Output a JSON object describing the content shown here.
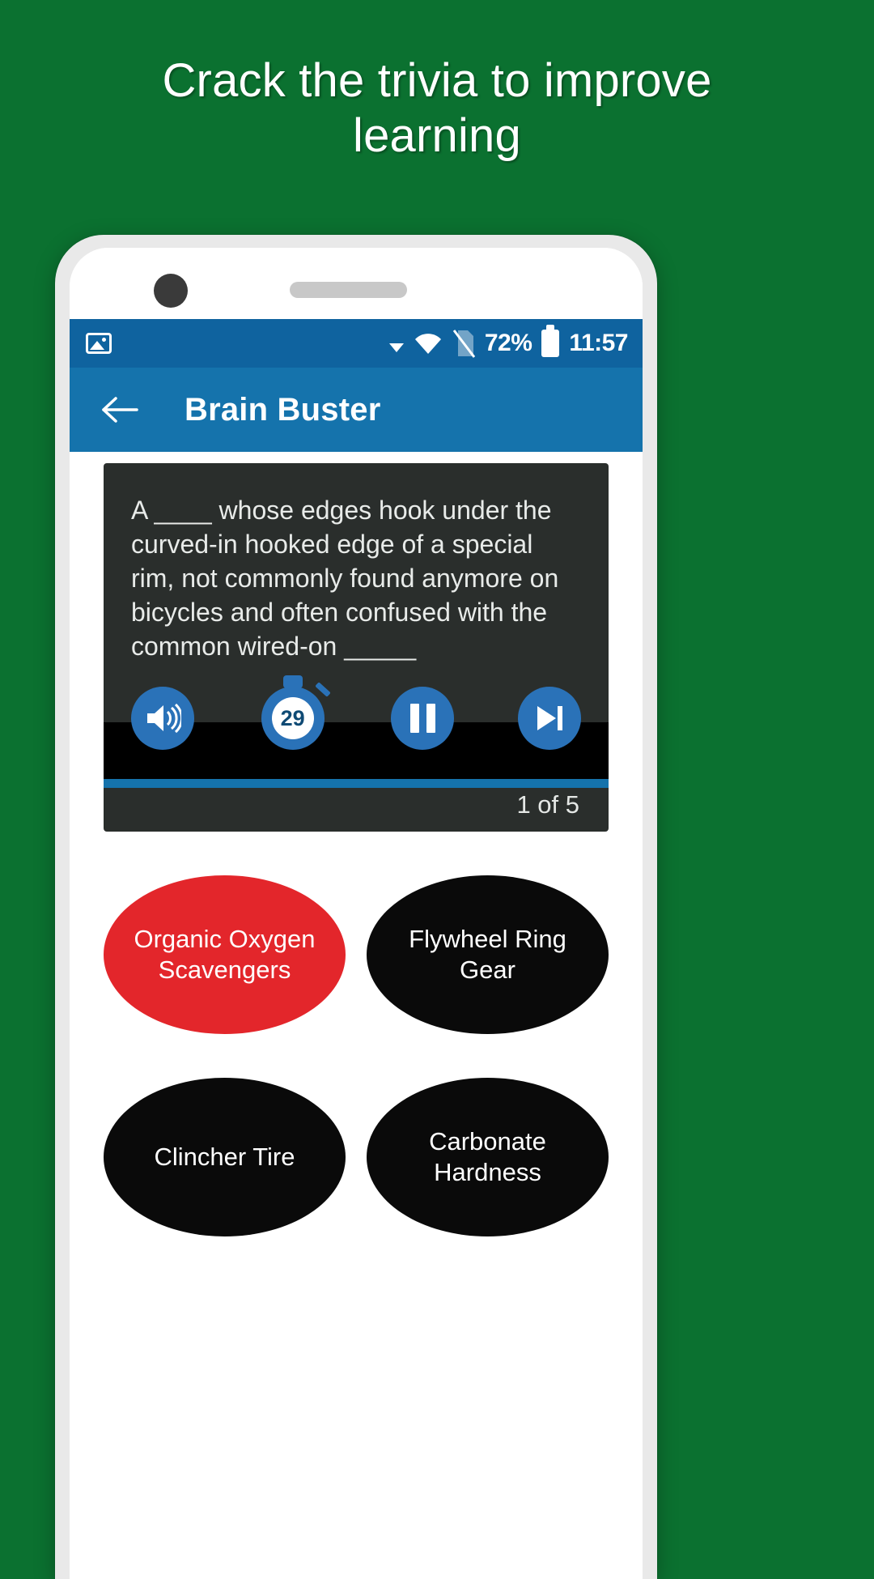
{
  "promo": {
    "headline": "Crack the trivia to improve learning",
    "background_color": "#0b7130",
    "text_color": "#ffffff"
  },
  "status_bar": {
    "background_color": "#0f639f",
    "left_icons": [
      "image-icon"
    ],
    "right_icons": [
      "caret-down-icon",
      "wifi-icon",
      "sim-card-off-icon"
    ],
    "battery_percent": "72%",
    "battery_icon": "battery-icon",
    "time": "11:57"
  },
  "app_bar": {
    "back_icon": "back-arrow-icon",
    "title": "Brain Buster",
    "background_color": "#1573ac",
    "text_color": "#ffffff"
  },
  "question_card": {
    "background_color": "#2a2e2c",
    "text": "A ____ whose edges hook under the curved-in hooked edge of a special rim, not commonly found anymore on bicycles and often confused with the common wired-on _____",
    "counter": "1 of 5",
    "progress_percent": 100,
    "progress_color": "#1573ac",
    "controls": [
      {
        "name": "volume-button",
        "icon": "volume-up-icon",
        "label": ""
      },
      {
        "name": "timer-button",
        "icon": "stopwatch-icon",
        "label": "29"
      },
      {
        "name": "pause-button",
        "icon": "pause-icon",
        "label": ""
      },
      {
        "name": "next-button",
        "icon": "skip-next-icon",
        "label": ""
      }
    ]
  },
  "answers": [
    {
      "label": "Organic Oxygen Scavengers",
      "state": "selected",
      "color": "#e3262b"
    },
    {
      "label": "Flywheel Ring Gear",
      "state": "default",
      "color": "#0a0a0a"
    },
    {
      "label": "Clincher Tire",
      "state": "default",
      "color": "#0a0a0a"
    },
    {
      "label": "Carbonate Hardness",
      "state": "default",
      "color": "#0a0a0a"
    }
  ]
}
